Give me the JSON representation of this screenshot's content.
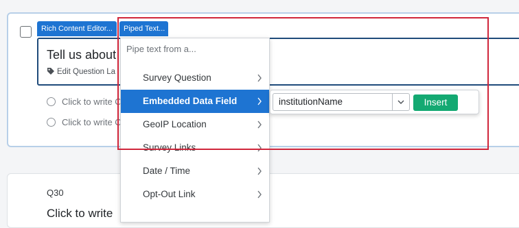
{
  "editor_tabs": {
    "rich_content": "Rich Content Editor...",
    "piped_text": "Piped Text..."
  },
  "question": {
    "text": "Tell us about",
    "edit_label": "Edit Question La",
    "choices": [
      "Click to write C",
      "Click to write C"
    ]
  },
  "next_question": {
    "number": "Q30",
    "text": "Click to write"
  },
  "pipe_menu": {
    "header": "Pipe text from a...",
    "items": [
      {
        "label": "Survey Question",
        "active": false
      },
      {
        "label": "Embedded Data Field",
        "active": true
      },
      {
        "label": "GeoIP Location",
        "active": false
      },
      {
        "label": "Survey Links",
        "active": false
      },
      {
        "label": "Date / Time",
        "active": false
      },
      {
        "label": "Opt-Out Link",
        "active": false
      }
    ]
  },
  "embedded_submenu": {
    "selected_field": "institutionName",
    "insert_label": "Insert"
  },
  "colors": {
    "accent": "#1e74d2",
    "insert_button": "#14a972",
    "highlight_box": "#d0253a"
  },
  "icons": [
    "tag-icon",
    "chevron-right-icon",
    "chevron-down-icon"
  ]
}
